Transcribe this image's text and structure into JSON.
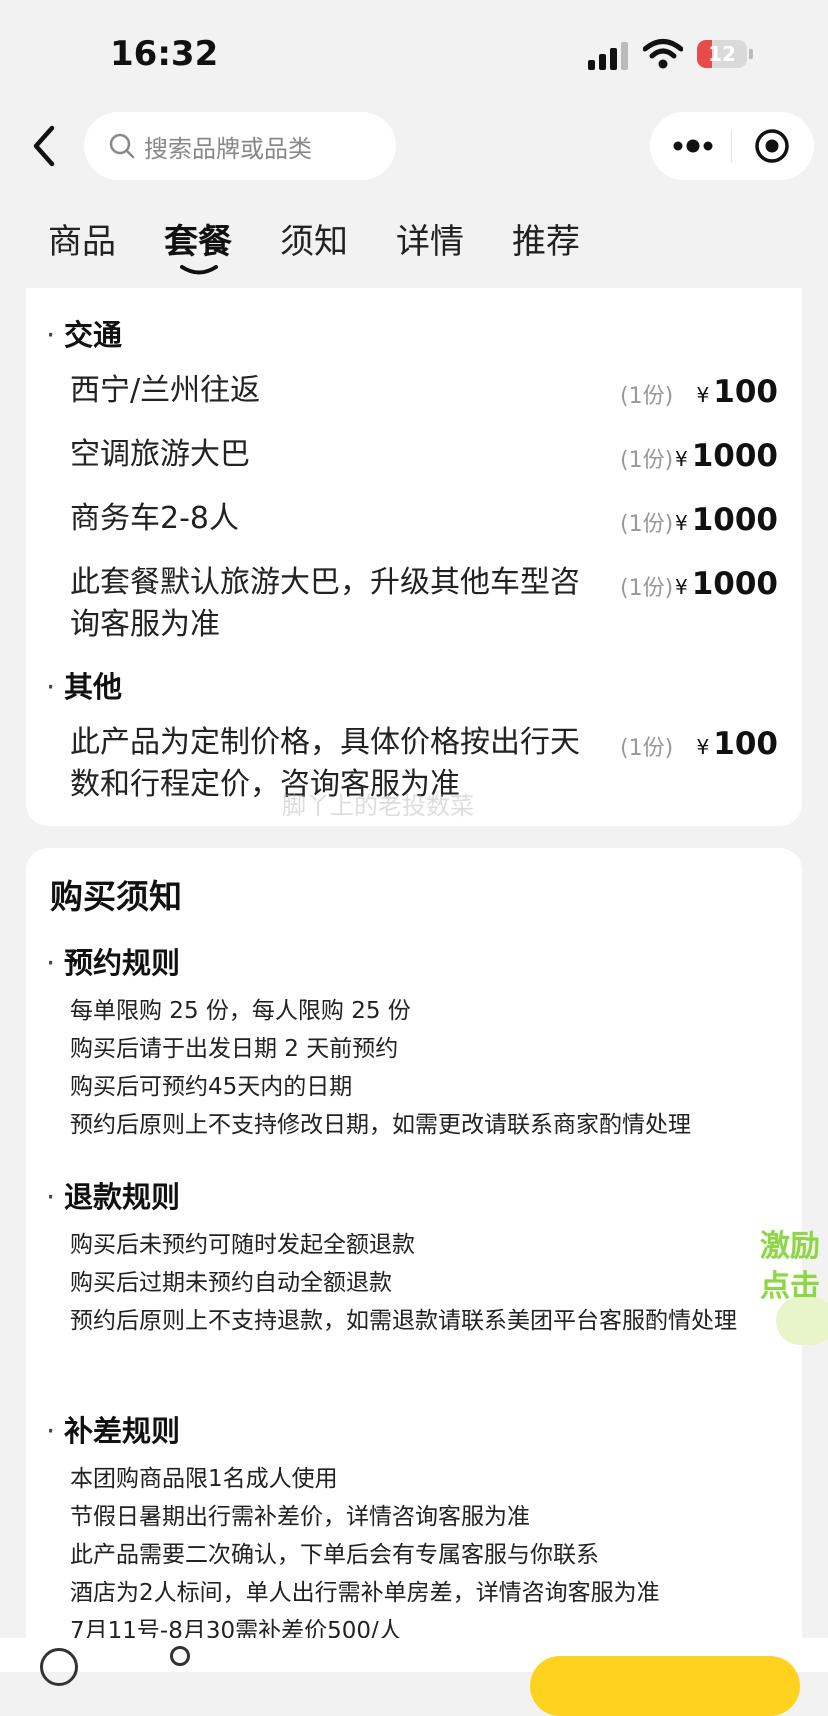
{
  "status_bar": {
    "time": "16:32",
    "battery": "12",
    "battery_level": 0.12
  },
  "search": {
    "placeholder": "搜索品牌或品类"
  },
  "tabs": [
    {
      "label": "商品"
    },
    {
      "label": "套餐"
    },
    {
      "label": "须知"
    },
    {
      "label": "详情"
    },
    {
      "label": "推荐"
    }
  ],
  "package": {
    "sections": [
      {
        "title": "交通",
        "items": [
          {
            "name": "西宁/兰州往返",
            "qty": "(1份)",
            "currency": "¥",
            "price": "100"
          },
          {
            "name": "空调旅游大巴",
            "qty": "(1份)",
            "currency": "¥",
            "price": "1000"
          },
          {
            "name": "商务车2-8人",
            "qty": "(1份)",
            "currency": "¥",
            "price": "1000"
          },
          {
            "name": "此套餐默认旅游大巴，升级其他车型咨询客服为准",
            "qty": "(1份)",
            "currency": "¥",
            "price": "1000"
          }
        ]
      },
      {
        "title": "其他",
        "items": [
          {
            "name": "此产品为定制价格，具体价格按出行天数和行程定价，咨询客服为准",
            "qty": "(1份)",
            "currency": "¥",
            "price": "100"
          }
        ]
      }
    ],
    "watermark": "脚丫上的老投数菜"
  },
  "notice": {
    "title": "购买须知",
    "sections": [
      {
        "title": "预约规则",
        "lines": [
          "每单限购 25 份，每人限购 25 份",
          "购买后请于出发日期 2 天前预约",
          "购买后可预约45天内的日期",
          "预约后原则上不支持修改日期，如需更改请联系商家酌情处理"
        ]
      },
      {
        "title": "退款规则",
        "lines": [
          "购买后未预约可随时发起全额退款",
          "购买后过期未预约自动全额退款",
          "预约后原则上不支持退款，如需退款请联系美团平台客服酌情处理"
        ]
      },
      {
        "title": "补差规则",
        "lines": [
          "本团购商品限1名成人使用",
          "节假日暑期出行需补差价，详情咨询客服为准",
          "此产品需要二次确认，下单后会有专属客服与你联系",
          "酒店为2人标间，单人出行需补单房差，详情咨询客服为准",
          "7月11号-8月30需补差价500/人"
        ]
      }
    ]
  },
  "floating_badge": {
    "line1": "激励",
    "line2": "点击"
  },
  "colors": {
    "accent_yellow": "#ffd21f",
    "badge_green": "#8fd44a",
    "battery_red": "#e64c4c"
  }
}
